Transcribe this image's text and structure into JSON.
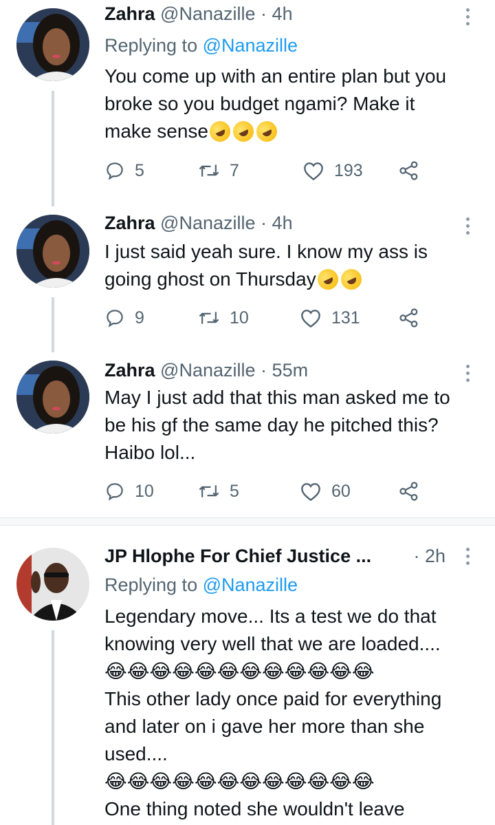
{
  "tweets": [
    {
      "name": "Zahra",
      "handle": "@Nanazille",
      "dot": "·",
      "time": "4h",
      "reply_prefix": "Replying to ",
      "reply_mention": "@Nanazille",
      "lines": [
        "You come up with an entire plan but you",
        "broke so you budget ngami? Make it",
        "make sense"
      ],
      "emoji_suffix": "🤣🤣🤣",
      "replies": "5",
      "retweets": "7",
      "likes": "193"
    },
    {
      "name": "Zahra",
      "handle": "@Nanazille",
      "dot": "·",
      "time": "4h",
      "lines": [
        "I just said yeah sure. I know my ass is",
        "going ghost on Thursday"
      ],
      "emoji_suffix": "🤣🤣",
      "replies": "9",
      "retweets": "10",
      "likes": "131"
    },
    {
      "name": "Zahra",
      "handle": "@Nanazille",
      "dot": "·",
      "time": "55m",
      "lines": [
        "May I just add that this man asked me to",
        "be his gf the same day he pitched this?",
        "Haibo lol..."
      ],
      "replies": "10",
      "retweets": "5",
      "likes": "60"
    },
    {
      "name": "JP Hlophe For Chief Justice ...",
      "dot": "·",
      "time": "2h",
      "reply_prefix": "Replying to ",
      "reply_mention": "@Nanazille",
      "lines": [
        "Legendary move... Its a test we do that",
        "knowing very well that we are loaded....",
        "😂😂😂😂😂😂😂😂😂😂😂😂",
        "This other lady once paid for everything",
        "and later on i gave her more than she",
        "used....",
        "😂😂😂😂😂😂😂😂😂😂😂😂",
        "One thing noted she wouldn't leave"
      ]
    }
  ],
  "icons": {
    "reply": "reply-icon",
    "retweet": "retweet-icon",
    "like": "heart-icon",
    "share": "share-icon",
    "more": "more-options-icon"
  },
  "colors": {
    "accent": "#1d9bf0",
    "muted": "#536471",
    "thread": "#cfd9de"
  }
}
